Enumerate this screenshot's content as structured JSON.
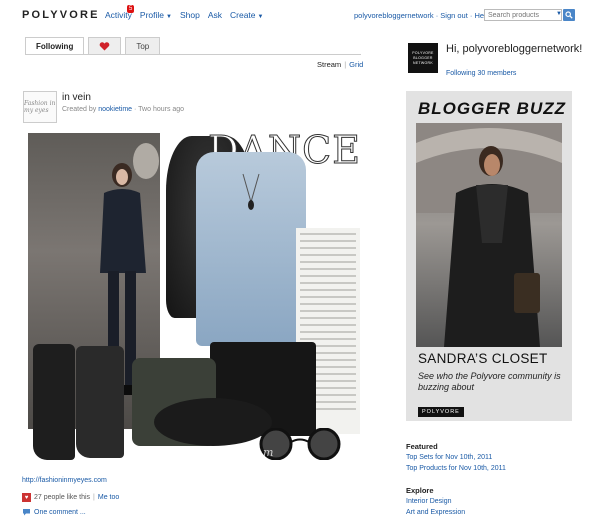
{
  "header": {
    "logo": "POLYVORE",
    "nav": [
      {
        "label": "Activity",
        "badge": "5"
      },
      {
        "label": "Profile",
        "dropdown": true
      },
      {
        "label": "Shop"
      },
      {
        "label": "Ask"
      },
      {
        "label": "Create",
        "dropdown": true
      }
    ],
    "account": "polyvorebloggernetwork · Sign out · Help",
    "search_placeholder": "Search products"
  },
  "tabs": {
    "items": [
      {
        "label": "Following",
        "active": true
      },
      {
        "label": "",
        "icon": "heart-icon"
      },
      {
        "label": "Top"
      }
    ]
  },
  "view_toggle": {
    "stream": "Stream",
    "grid": "Grid"
  },
  "post": {
    "avatar_text": "Fashion in my eyes",
    "title": "in vein",
    "meta_prefix": "Created by",
    "author": "nookietime",
    "meta_suffix": " · Two hours ago",
    "collage_text": "DANCE",
    "watermark": "fashioninmyeyes.com",
    "source_link": "http://fashioninmyeyes.com",
    "likes_text": "27 people like this",
    "me_too": "Me too",
    "comments_text": "One comment ..."
  },
  "sidebar": {
    "logo_text": "POLYVORE BLOGGER NETWORK",
    "greeting": "Hi, polyvorebloggernetwork!",
    "following": "Following 30 members",
    "ad": {
      "title": "BLOGGER BUZZ",
      "heading": "SANDRA’S CLOSET",
      "text": "See who the Polyvore community is buzzing about",
      "brand": "POLYVORE"
    },
    "featured": {
      "heading": "Featured",
      "links": [
        "Top Sets for Nov 10th, 2011",
        "Top Products for Nov 10th, 2011"
      ]
    },
    "explore": {
      "heading": "Explore",
      "links": [
        "Interior Design",
        "Art and Expression"
      ]
    }
  },
  "colors": {
    "link": "#1a5aa6",
    "badge": "#dd1111",
    "heart": "#cc3333",
    "ad_bg": "#e2e2e2"
  }
}
